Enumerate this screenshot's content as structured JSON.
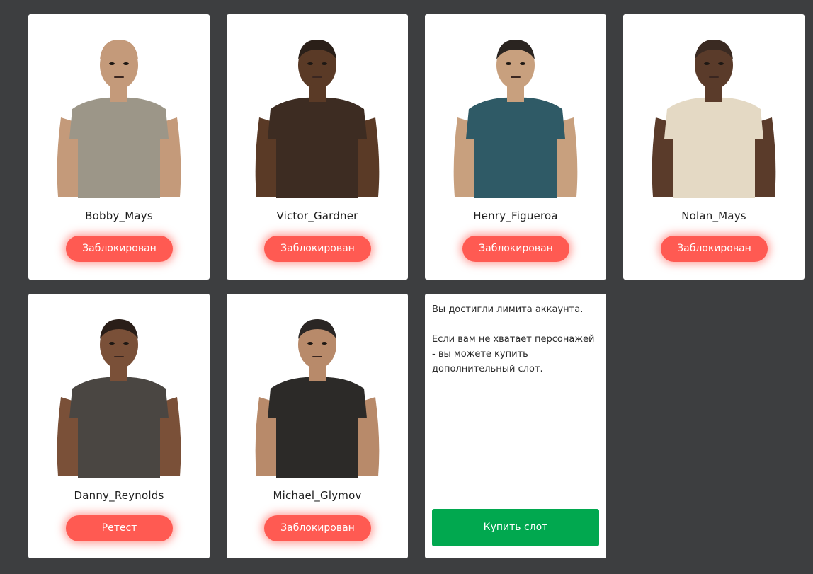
{
  "characters": [
    {
      "name": "Bobby_Mays",
      "status": "Заблокирован",
      "portrait": "avatar-army-shirt",
      "colors": {
        "shirt": "#9c9688",
        "skin": "#c49a7a",
        "hair": "#c49a7a"
      }
    },
    {
      "name": "Victor_Gardner",
      "status": "Заблокирован",
      "portrait": "avatar-tank-top",
      "colors": {
        "shirt": "#3d2c22",
        "skin": "#5a3a26",
        "hair": "#2a1f18"
      }
    },
    {
      "name": "Henry_Figueroa",
      "status": "Заблокирован",
      "portrait": "avatar-patterned-vest",
      "colors": {
        "shirt": "#2f5a66",
        "skin": "#c8a07e",
        "hair": "#2a2420"
      }
    },
    {
      "name": "Nolan_Mays",
      "status": "Заблокирован",
      "portrait": "avatar-floral-shirt",
      "colors": {
        "shirt": "#e4d9c4",
        "skin": "#5a3b2a",
        "hair": "#3a2a22"
      }
    },
    {
      "name": "Danny_Reynolds",
      "status": "Ретест",
      "portrait": "avatar-sweater-vest",
      "colors": {
        "shirt": "#4a4642",
        "skin": "#7a5038",
        "hair": "#2a1e18"
      }
    },
    {
      "name": "Michael_Glymov",
      "status": "Заблокирован",
      "portrait": "avatar-black-tee",
      "colors": {
        "shirt": "#2c2a28",
        "skin": "#b88a6a",
        "hair": "#2a2624"
      }
    }
  ],
  "limit_panel": {
    "message": "Вы достигли лимита аккаунта.",
    "hint": "Если вам не хватает персонажей - вы можете купить дополнительный слот.",
    "buy_label": "Купить слот"
  },
  "colors": {
    "background": "#3d3e40",
    "card": "#ffffff",
    "status_button": "#ff5a52",
    "buy_button": "#01a84f"
  }
}
